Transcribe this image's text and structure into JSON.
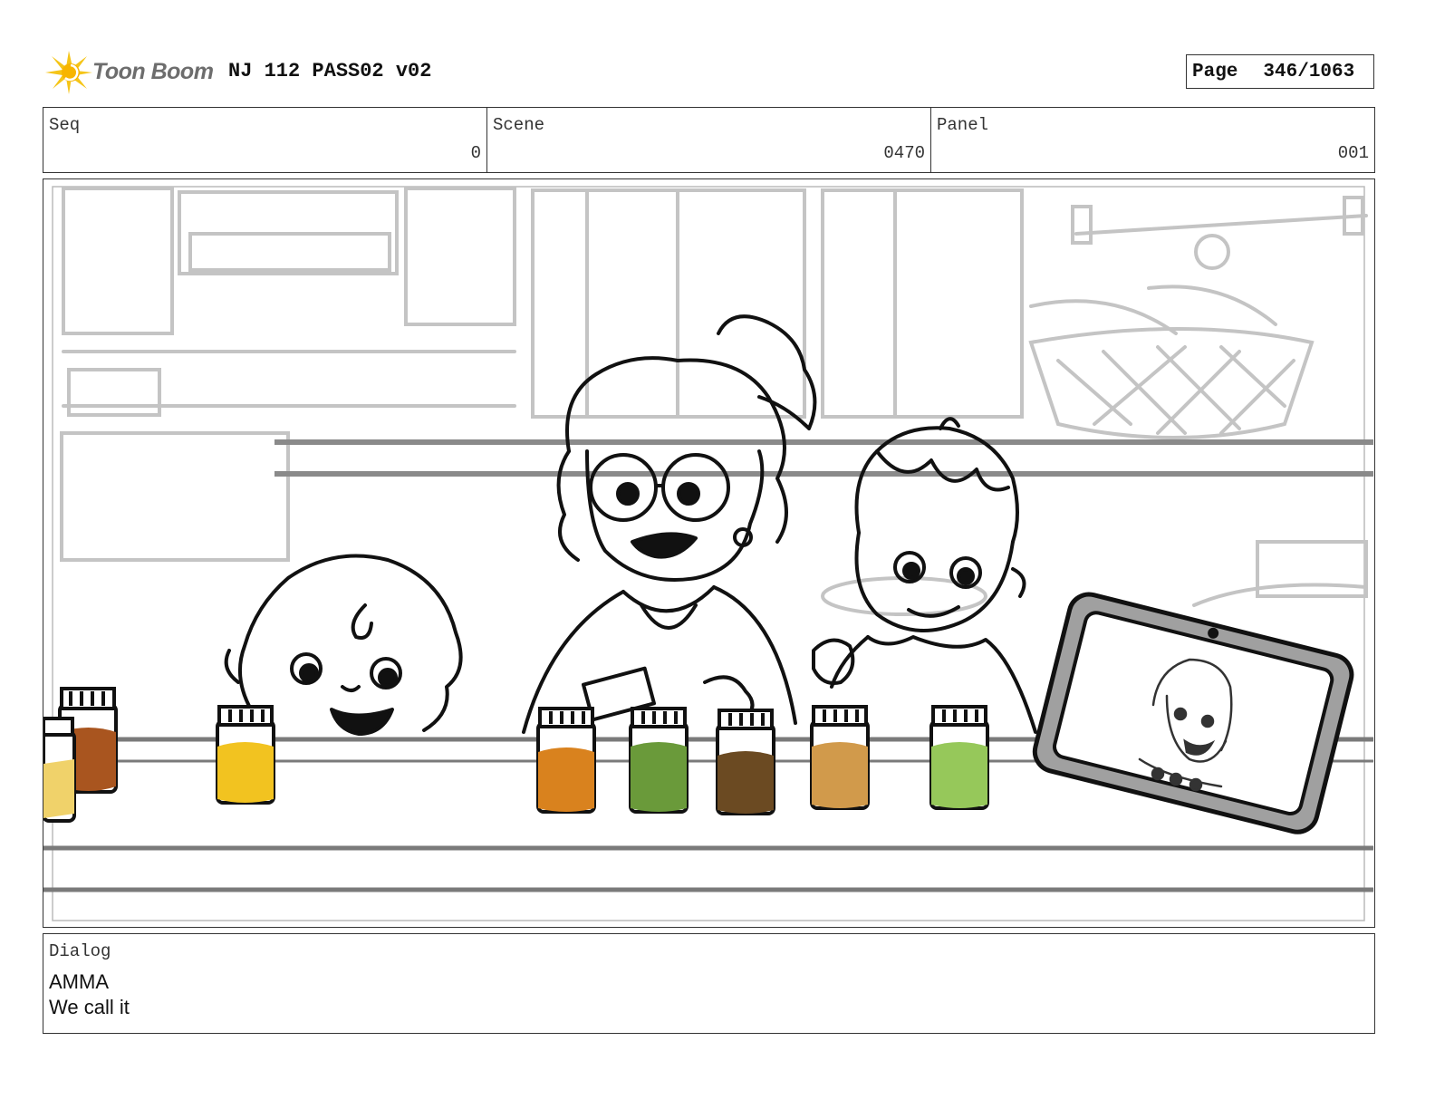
{
  "header": {
    "logo_text": "Toon Boom",
    "project_title": "NJ 112 PASS02 v02",
    "page_label": "Page",
    "page_number": "346/1063"
  },
  "info": {
    "seq_label": "Seq",
    "seq_value": "0",
    "scene_label": "Scene",
    "scene_value": "0470",
    "panel_label": "Panel",
    "panel_value": "001"
  },
  "dialog": {
    "label": "Dialog",
    "speaker": "AMMA",
    "line": "We call it"
  },
  "colors": {
    "logo_burst": "#f5c518",
    "jar_orange": "#d9821e",
    "jar_green": "#6a9a3a",
    "jar_brown": "#6b4a22",
    "jar_tan": "#d19a4b",
    "jar_light_green": "#96c85a",
    "jar_yellow": "#f2c320",
    "jar_rust": "#a9551f"
  }
}
